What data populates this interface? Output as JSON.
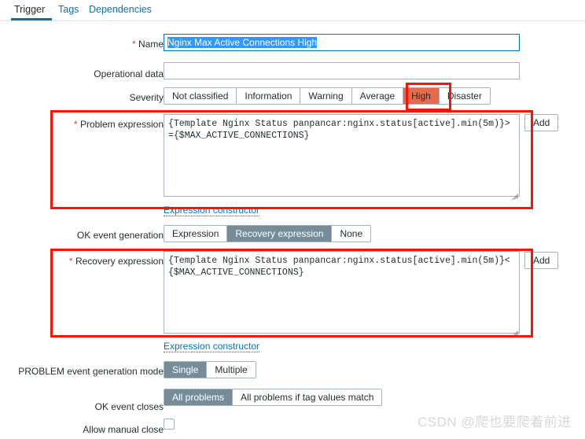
{
  "tabs": [
    {
      "label": "Trigger",
      "active": true
    },
    {
      "label": "Tags",
      "active": false
    },
    {
      "label": "Dependencies",
      "active": false
    }
  ],
  "form": {
    "name": {
      "label": "Name",
      "required": true,
      "value": "Nginx Max Active Connections High",
      "selected": true,
      "focused": true
    },
    "operational_data": {
      "label": "Operational data",
      "required": false,
      "value": "",
      "placeholder": ""
    },
    "severity": {
      "label": "Severity",
      "options": [
        "Not classified",
        "Information",
        "Warning",
        "Average",
        "High",
        "Disaster"
      ],
      "selected": "High",
      "selected_color": "#e8694b"
    },
    "problem_expression": {
      "label": "Problem expression",
      "required": true,
      "value": "{Template Nginx Status panpancar:nginx.status[active].min(5m)}>={$MAX_ACTIVE_CONNECTIONS}",
      "add_button": "Add",
      "constructor_link": "Expression constructor"
    },
    "ok_event_generation": {
      "label": "OK event generation",
      "options": [
        "Expression",
        "Recovery expression",
        "None"
      ],
      "selected": "Recovery expression"
    },
    "recovery_expression": {
      "label": "Recovery expression",
      "required": true,
      "value": "{Template Nginx Status panpancar:nginx.status[active].min(5m)}<{$MAX_ACTIVE_CONNECTIONS}",
      "add_button": "Add",
      "constructor_link": "Expression constructor"
    },
    "problem_event_generation_mode": {
      "label": "PROBLEM event generation mode",
      "options": [
        "Single",
        "Multiple"
      ],
      "selected": "Single"
    },
    "ok_event_closes": {
      "label": "OK event closes",
      "options": [
        "All problems",
        "All problems if tag values match"
      ],
      "selected": "All problems"
    },
    "allow_manual_close": {
      "label": "Allow manual close",
      "checked": false
    }
  },
  "annotations": {
    "accent_color": "#fa1405",
    "boxes": [
      "severity-high",
      "problem-expression",
      "recovery-expression"
    ]
  },
  "watermark": {
    "text": "CSDN @爬也要爬着前进"
  }
}
